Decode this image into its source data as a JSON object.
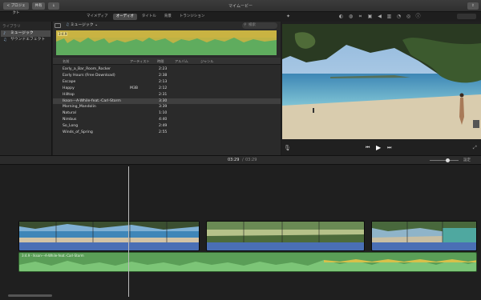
{
  "window": {
    "title": "マイムービー",
    "back_button": "< プロジェクト",
    "share_button": "共有",
    "extra_button": "↓"
  },
  "media_tabs": [
    {
      "label": "マイメディア",
      "active": false
    },
    {
      "label": "オーディオ",
      "active": true
    },
    {
      "label": "タイトル",
      "active": false
    },
    {
      "label": "背景",
      "active": false
    },
    {
      "label": "トランジション",
      "active": false
    }
  ],
  "sidebar": {
    "heading": "ライブラリ",
    "items": [
      {
        "label": "ミュージック",
        "selected": true
      },
      {
        "label": "サウンドエフェクト",
        "selected": false
      }
    ]
  },
  "browser": {
    "source_dropdown": "ミュージック",
    "search_placeholder": "検索",
    "columns": {
      "name": "名前",
      "artist": "アーティスト",
      "time": "時間",
      "album": "アルバム",
      "genre": "ジャンル"
    },
    "rows": [
      {
        "name": "Early_a_Bar_Room_Rocker",
        "artist": "",
        "time": "2:23",
        "selected": false
      },
      {
        "name": "Early Hours (Free Download)",
        "artist": "",
        "time": "2:38",
        "selected": false
      },
      {
        "name": "Escape",
        "artist": "",
        "time": "2:13",
        "selected": false
      },
      {
        "name": "Happy",
        "artist": "M3B",
        "time": "2:12",
        "selected": false
      },
      {
        "name": "Hilltop",
        "artist": "",
        "time": "2:31",
        "selected": false
      },
      {
        "name": "Ikson---A-While-feat.-Carl-Storm",
        "artist": "",
        "time": "3:30",
        "selected": true
      },
      {
        "name": "Morning_Mandolin",
        "artist": "",
        "time": "3:39",
        "selected": false
      },
      {
        "name": "Natural",
        "artist": "",
        "time": "1:10",
        "selected": false
      },
      {
        "name": "Nimbus",
        "artist": "",
        "time": "4:40",
        "selected": false
      },
      {
        "name": "So_Long",
        "artist": "",
        "time": "2:49",
        "selected": false
      },
      {
        "name": "Winds_of_Spring",
        "artist": "",
        "time": "2:55",
        "selected": false
      }
    ],
    "waveform_label": "3:4.9"
  },
  "timeline": {
    "current_time": "03:29",
    "total_time": "03:29",
    "settings_label": "設定",
    "music_clip_label": "3:4.9 - Ikson---A-While-feat.-Carl-Storm"
  },
  "colors": {
    "accent": "#3d6bd6",
    "audio_green": "#5fac5e",
    "waveform_yellow": "#c9b342",
    "clip_audio_blue": "#4a6fb5"
  }
}
